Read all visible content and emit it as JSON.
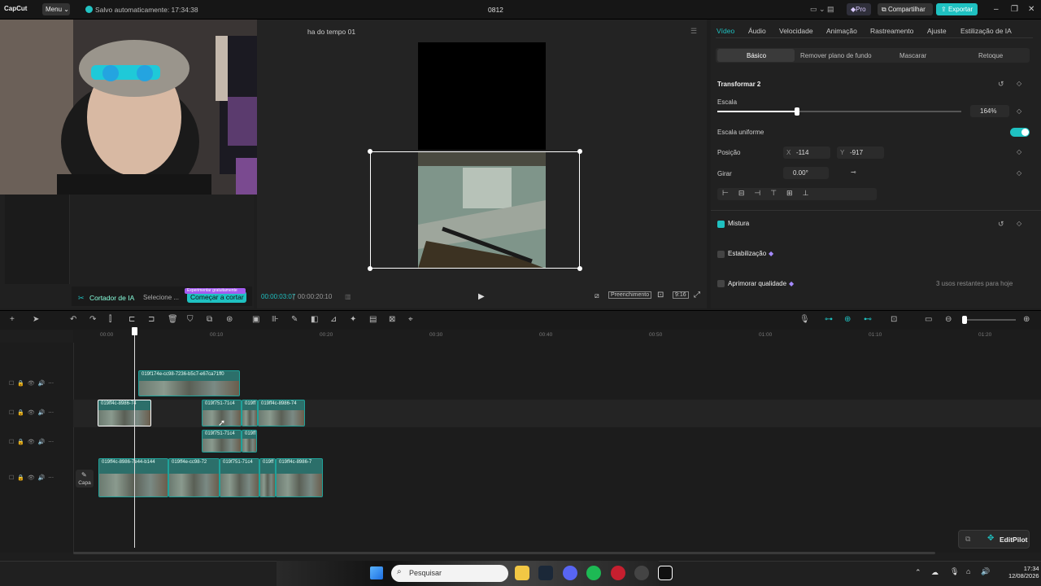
{
  "topbar": {
    "logo": "CapCut",
    "menu_label": "Menu",
    "save_status": "Salvo automaticamente: 17:34:38",
    "project_title": "0812",
    "pro_label": "Pro",
    "share_label": "Compartilhar",
    "export_label": "Exportar"
  },
  "left_panel": {
    "ai_cutter_label": "Cortador de IA",
    "select_label": "Selecione ...",
    "start_cut_label": "Começar a cortar",
    "trial_tag": "Experimentar gratuitamente"
  },
  "player": {
    "title": "ha do tempo 01",
    "time_current": "00:00:03:07",
    "time_total": "00:00:20:10",
    "fill_label": "Preenchimento",
    "ratio_label": "9:16"
  },
  "inspector": {
    "tabs": [
      "Vídeo",
      "Áudio",
      "Velocidade",
      "Animação",
      "Rastreamento",
      "Ajuste",
      "Estilização de IA"
    ],
    "subtabs": [
      "Básico",
      "Remover plano de fundo",
      "Mascarar",
      "Retoque"
    ],
    "transform_title": "Transformar 2",
    "scale_label": "Escala",
    "scale_value": "164%",
    "uniform_scale_label": "Escala uniforme",
    "position_label": "Posição",
    "pos_x_label": "X",
    "pos_x_value": "-114",
    "pos_y_label": "Y",
    "pos_y_value": "-917",
    "rotate_label": "Girar",
    "rotate_value": "0.00°",
    "blend_label": "Mistura",
    "stabilize_label": "Estabilização",
    "enhance_label": "Aprimorar qualidade",
    "remaining_uses": "3 usos restantes para hoje"
  },
  "timeline": {
    "ruler_ticks": [
      "00:00",
      "00:10",
      "00:20",
      "00:30",
      "00:40",
      "00:50",
      "01:00",
      "01:10",
      "01:20"
    ],
    "clips_track1": [
      "019f174e-cc98-7236-b5c7-e67ca71ff0"
    ],
    "clips_track2": [
      "019ff4c-8986-74",
      "019f751-71c4",
      "019ff",
      "019ff4c-8986-74"
    ],
    "clips_track3": [
      "019f751-71c4",
      "019ff"
    ],
    "clips_track4": [
      "019ff4c-8986-7e44-b144",
      "019ff4e-cc98-72",
      "019f751-71c4",
      "019ff",
      "019ff4c-8986-7"
    ],
    "cover_label": "Capa",
    "editpilot_label": "EditPilot"
  },
  "taskbar": {
    "search_placeholder": "Pesquisar",
    "time": "17:34",
    "date": "12/08/2026"
  },
  "colors": {
    "accent": "#1fc1c1",
    "clip": "#2c6f6a"
  }
}
